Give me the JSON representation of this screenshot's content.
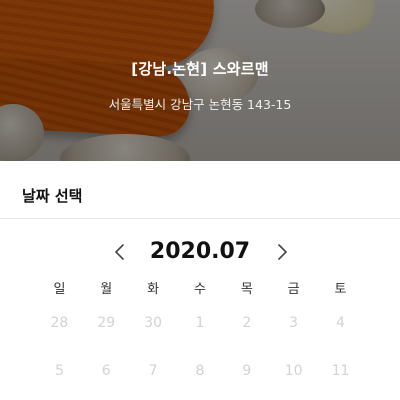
{
  "hero": {
    "title": "[강남.논현] 스와르맨",
    "address": "서울특별시 강남구 논현동 143-15"
  },
  "date_section": {
    "title": "날짜 선택"
  },
  "calendar": {
    "month_label": "2020.07",
    "prev_icon": "chevron-left-icon",
    "next_icon": "chevron-right-icon",
    "weekdays": [
      "일",
      "월",
      "화",
      "수",
      "목",
      "금",
      "토"
    ],
    "weeks": [
      [
        "28",
        "29",
        "30",
        "1",
        "2",
        "3",
        "4"
      ],
      [
        "5",
        "6",
        "7",
        "8",
        "9",
        "10",
        "11"
      ]
    ],
    "disabled_color": "#d3d3d3"
  }
}
